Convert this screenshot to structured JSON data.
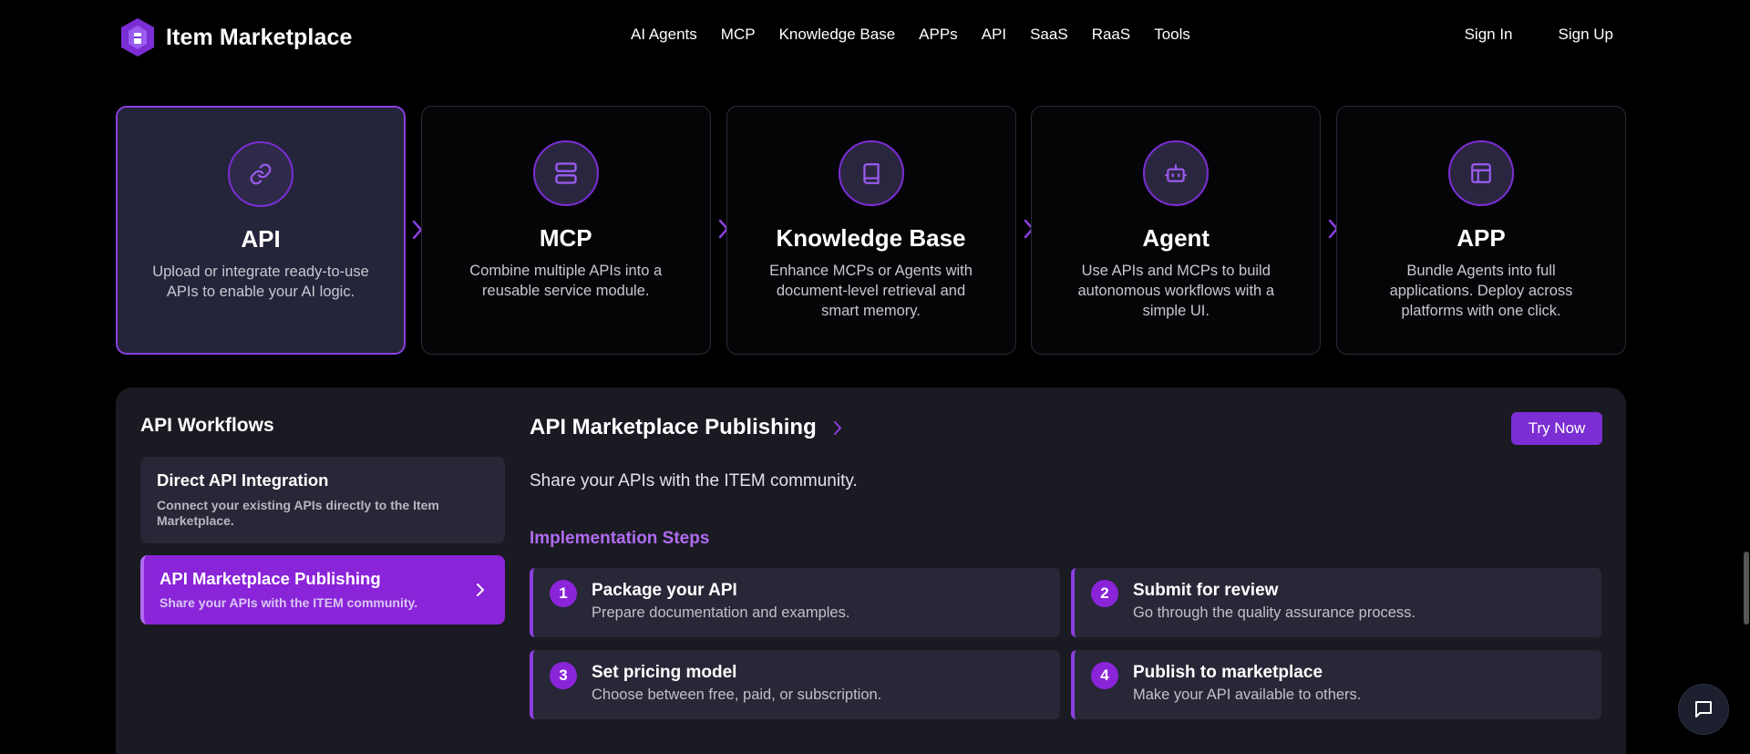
{
  "header": {
    "brand_name": "Item Marketplace",
    "nav": [
      "AI Agents",
      "MCP",
      "Knowledge Base",
      "APPs",
      "API",
      "SaaS",
      "RaaS",
      "Tools"
    ],
    "sign_in": "Sign In",
    "sign_up": "Sign Up"
  },
  "cards": [
    {
      "title": "API",
      "desc": "Upload or integrate ready-to-use APIs to enable your AI logic.",
      "icon": "link-icon",
      "active": true
    },
    {
      "title": "MCP",
      "desc": "Combine multiple APIs into a reusable service module.",
      "icon": "server-icon",
      "active": false
    },
    {
      "title": "Knowledge Base",
      "desc": "Enhance MCPs or Agents with document-level retrieval and smart memory.",
      "icon": "book-icon",
      "active": false
    },
    {
      "title": "Agent",
      "desc": "Use APIs and MCPs to build autonomous workflows with a simple UI.",
      "icon": "bot-icon",
      "active": false
    },
    {
      "title": "APP",
      "desc": "Bundle Agents into full applications. Deploy across platforms with one click.",
      "icon": "layout-icon",
      "active": false
    }
  ],
  "workflows": {
    "title": "API Workflows",
    "items": [
      {
        "title": "Direct API Integration",
        "desc": "Connect your existing APIs directly to the Item Marketplace."
      },
      {
        "title": "API Marketplace Publishing",
        "desc": "Share your APIs with the ITEM community."
      }
    ]
  },
  "detail": {
    "title": "API Marketplace Publishing",
    "try_now": "Try Now",
    "subtitle": "Share your APIs with the ITEM community.",
    "steps_title": "Implementation Steps",
    "steps": [
      {
        "num": "1",
        "title": "Package your API",
        "desc": "Prepare documentation and examples."
      },
      {
        "num": "2",
        "title": "Submit for review",
        "desc": "Go through the quality assurance process."
      },
      {
        "num": "3",
        "title": "Set pricing model",
        "desc": "Choose between free, paid, or subscription."
      },
      {
        "num": "4",
        "title": "Publish to marketplace",
        "desc": "Make your API available to others."
      }
    ]
  },
  "colors": {
    "accent": "#8a24d8",
    "accent_light": "#b06cf0",
    "panel_bg": "#1a1a22",
    "card_active_bg": "#24243a"
  }
}
